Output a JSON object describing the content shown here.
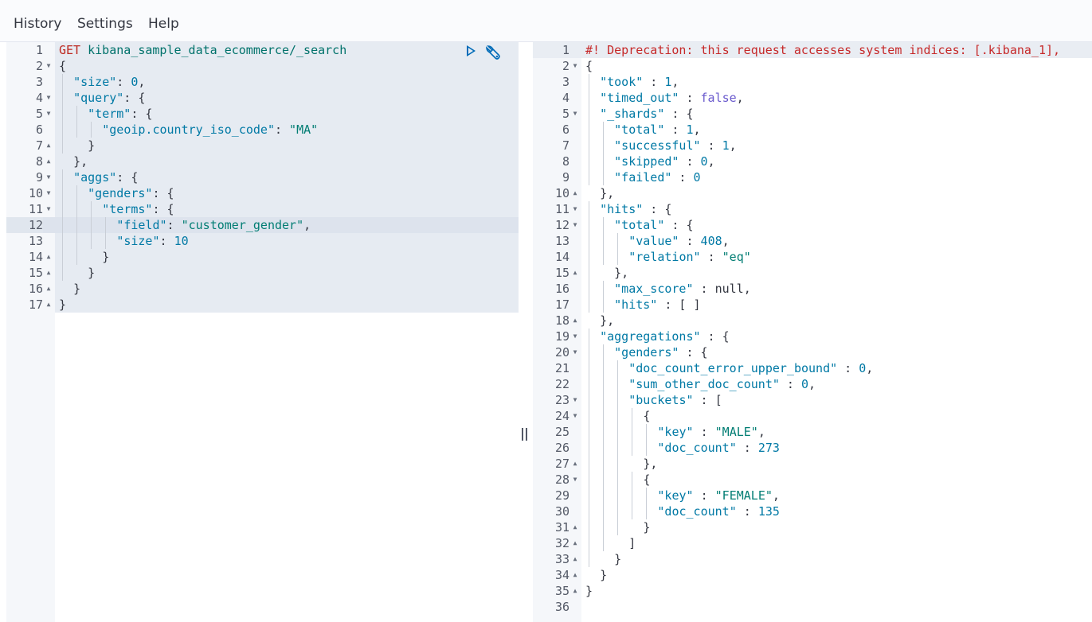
{
  "menu": {
    "history": "History",
    "settings": "Settings",
    "help": "Help"
  },
  "request": {
    "method": "GET",
    "path": "kibana_sample_data_ecommerce/_search",
    "lines": [
      {
        "n": "1",
        "fold": "",
        "indent": 0,
        "tokens": []
      },
      {
        "n": "2",
        "fold": "▼",
        "indent": 0,
        "tokens": [
          [
            "p",
            "{"
          ]
        ]
      },
      {
        "n": "3",
        "fold": "",
        "indent": 1,
        "tokens": [
          [
            "k",
            "\"size\""
          ],
          [
            "p",
            ": "
          ],
          [
            "n",
            "0"
          ],
          [
            "p",
            ","
          ]
        ]
      },
      {
        "n": "4",
        "fold": "▼",
        "indent": 1,
        "tokens": [
          [
            "k",
            "\"query\""
          ],
          [
            "p",
            ": {"
          ]
        ]
      },
      {
        "n": "5",
        "fold": "▼",
        "indent": 2,
        "tokens": [
          [
            "k",
            "\"term\""
          ],
          [
            "p",
            ": {"
          ]
        ]
      },
      {
        "n": "6",
        "fold": "",
        "indent": 3,
        "tokens": [
          [
            "k",
            "\"geoip.country_iso_code\""
          ],
          [
            "p",
            ": "
          ],
          [
            "s",
            "\"MA\""
          ]
        ]
      },
      {
        "n": "7",
        "fold": "▲",
        "indent": 2,
        "tokens": [
          [
            "p",
            "}"
          ]
        ]
      },
      {
        "n": "8",
        "fold": "▲",
        "indent": 1,
        "tokens": [
          [
            "p",
            "},"
          ]
        ]
      },
      {
        "n": "9",
        "fold": "▼",
        "indent": 1,
        "tokens": [
          [
            "k",
            "\"aggs\""
          ],
          [
            "p",
            ": {"
          ]
        ]
      },
      {
        "n": "10",
        "fold": "▼",
        "indent": 2,
        "tokens": [
          [
            "k",
            "\"genders\""
          ],
          [
            "p",
            ": {"
          ]
        ]
      },
      {
        "n": "11",
        "fold": "▼",
        "indent": 3,
        "tokens": [
          [
            "k",
            "\"terms\""
          ],
          [
            "p",
            ": {"
          ]
        ]
      },
      {
        "n": "12",
        "fold": "",
        "indent": 4,
        "tokens": [
          [
            "k",
            "\"field\""
          ],
          [
            "p",
            ": "
          ],
          [
            "s",
            "\"customer_gender\""
          ],
          [
            "p",
            ","
          ]
        ]
      },
      {
        "n": "13",
        "fold": "",
        "indent": 4,
        "tokens": [
          [
            "k",
            "\"size\""
          ],
          [
            "p",
            ": "
          ],
          [
            "n",
            "10"
          ]
        ]
      },
      {
        "n": "14",
        "fold": "▲",
        "indent": 3,
        "tokens": [
          [
            "p",
            "}"
          ]
        ]
      },
      {
        "n": "15",
        "fold": "▲",
        "indent": 2,
        "tokens": [
          [
            "p",
            "}"
          ]
        ]
      },
      {
        "n": "16",
        "fold": "▲",
        "indent": 1,
        "tokens": [
          [
            "p",
            "}"
          ]
        ]
      },
      {
        "n": "17",
        "fold": "▲",
        "indent": 0,
        "tokens": [
          [
            "p",
            "}"
          ]
        ]
      }
    ]
  },
  "response": {
    "lines": [
      {
        "n": "1",
        "fold": "",
        "indent": 0,
        "tokens": [
          [
            "w",
            "#! Deprecation: this request accesses system indices: [.kibana_1],"
          ]
        ]
      },
      {
        "n": "2",
        "fold": "▼",
        "indent": 0,
        "tokens": [
          [
            "p",
            "{"
          ]
        ]
      },
      {
        "n": "3",
        "fold": "",
        "indent": 1,
        "tokens": [
          [
            "k",
            "\"took\""
          ],
          [
            "p",
            " : "
          ],
          [
            "n",
            "1"
          ],
          [
            "p",
            ","
          ]
        ]
      },
      {
        "n": "4",
        "fold": "",
        "indent": 1,
        "tokens": [
          [
            "k",
            "\"timed_out\""
          ],
          [
            "p",
            " : "
          ],
          [
            "b",
            "false"
          ],
          [
            "p",
            ","
          ]
        ]
      },
      {
        "n": "5",
        "fold": "▼",
        "indent": 1,
        "tokens": [
          [
            "k",
            "\"_shards\""
          ],
          [
            "p",
            " : {"
          ]
        ]
      },
      {
        "n": "6",
        "fold": "",
        "indent": 2,
        "tokens": [
          [
            "k",
            "\"total\""
          ],
          [
            "p",
            " : "
          ],
          [
            "n",
            "1"
          ],
          [
            "p",
            ","
          ]
        ]
      },
      {
        "n": "7",
        "fold": "",
        "indent": 2,
        "tokens": [
          [
            "k",
            "\"successful\""
          ],
          [
            "p",
            " : "
          ],
          [
            "n",
            "1"
          ],
          [
            "p",
            ","
          ]
        ]
      },
      {
        "n": "8",
        "fold": "",
        "indent": 2,
        "tokens": [
          [
            "k",
            "\"skipped\""
          ],
          [
            "p",
            " : "
          ],
          [
            "n",
            "0"
          ],
          [
            "p",
            ","
          ]
        ]
      },
      {
        "n": "9",
        "fold": "",
        "indent": 2,
        "tokens": [
          [
            "k",
            "\"failed\""
          ],
          [
            "p",
            " : "
          ],
          [
            "n",
            "0"
          ]
        ]
      },
      {
        "n": "10",
        "fold": "▲",
        "indent": 1,
        "tokens": [
          [
            "p",
            "},"
          ]
        ]
      },
      {
        "n": "11",
        "fold": "▼",
        "indent": 1,
        "tokens": [
          [
            "k",
            "\"hits\""
          ],
          [
            "p",
            " : {"
          ]
        ]
      },
      {
        "n": "12",
        "fold": "▼",
        "indent": 2,
        "tokens": [
          [
            "k",
            "\"total\""
          ],
          [
            "p",
            " : {"
          ]
        ]
      },
      {
        "n": "13",
        "fold": "",
        "indent": 3,
        "tokens": [
          [
            "k",
            "\"value\""
          ],
          [
            "p",
            " : "
          ],
          [
            "n",
            "408"
          ],
          [
            "p",
            ","
          ]
        ]
      },
      {
        "n": "14",
        "fold": "",
        "indent": 3,
        "tokens": [
          [
            "k",
            "\"relation\""
          ],
          [
            "p",
            " : "
          ],
          [
            "s",
            "\"eq\""
          ]
        ]
      },
      {
        "n": "15",
        "fold": "▲",
        "indent": 2,
        "tokens": [
          [
            "p",
            "},"
          ]
        ]
      },
      {
        "n": "16",
        "fold": "",
        "indent": 2,
        "tokens": [
          [
            "k",
            "\"max_score\""
          ],
          [
            "p",
            " : "
          ],
          [
            "z",
            "null"
          ],
          [
            "p",
            ","
          ]
        ]
      },
      {
        "n": "17",
        "fold": "",
        "indent": 2,
        "tokens": [
          [
            "k",
            "\"hits\""
          ],
          [
            "p",
            " : [ ]"
          ]
        ]
      },
      {
        "n": "18",
        "fold": "▲",
        "indent": 1,
        "tokens": [
          [
            "p",
            "},"
          ]
        ]
      },
      {
        "n": "19",
        "fold": "▼",
        "indent": 1,
        "tokens": [
          [
            "k",
            "\"aggregations\""
          ],
          [
            "p",
            " : {"
          ]
        ]
      },
      {
        "n": "20",
        "fold": "▼",
        "indent": 2,
        "tokens": [
          [
            "k",
            "\"genders\""
          ],
          [
            "p",
            " : {"
          ]
        ]
      },
      {
        "n": "21",
        "fold": "",
        "indent": 3,
        "tokens": [
          [
            "k",
            "\"doc_count_error_upper_bound\""
          ],
          [
            "p",
            " : "
          ],
          [
            "n",
            "0"
          ],
          [
            "p",
            ","
          ]
        ]
      },
      {
        "n": "22",
        "fold": "",
        "indent": 3,
        "tokens": [
          [
            "k",
            "\"sum_other_doc_count\""
          ],
          [
            "p",
            " : "
          ],
          [
            "n",
            "0"
          ],
          [
            "p",
            ","
          ]
        ]
      },
      {
        "n": "23",
        "fold": "▼",
        "indent": 3,
        "tokens": [
          [
            "k",
            "\"buckets\""
          ],
          [
            "p",
            " : ["
          ]
        ]
      },
      {
        "n": "24",
        "fold": "▼",
        "indent": 4,
        "tokens": [
          [
            "p",
            "{"
          ]
        ]
      },
      {
        "n": "25",
        "fold": "",
        "indent": 5,
        "tokens": [
          [
            "k",
            "\"key\""
          ],
          [
            "p",
            " : "
          ],
          [
            "s",
            "\"MALE\""
          ],
          [
            "p",
            ","
          ]
        ]
      },
      {
        "n": "26",
        "fold": "",
        "indent": 5,
        "tokens": [
          [
            "k",
            "\"doc_count\""
          ],
          [
            "p",
            " : "
          ],
          [
            "n",
            "273"
          ]
        ]
      },
      {
        "n": "27",
        "fold": "▲",
        "indent": 4,
        "tokens": [
          [
            "p",
            "},"
          ]
        ]
      },
      {
        "n": "28",
        "fold": "▼",
        "indent": 4,
        "tokens": [
          [
            "p",
            "{"
          ]
        ]
      },
      {
        "n": "29",
        "fold": "",
        "indent": 5,
        "tokens": [
          [
            "k",
            "\"key\""
          ],
          [
            "p",
            " : "
          ],
          [
            "s",
            "\"FEMALE\""
          ],
          [
            "p",
            ","
          ]
        ]
      },
      {
        "n": "30",
        "fold": "",
        "indent": 5,
        "tokens": [
          [
            "k",
            "\"doc_count\""
          ],
          [
            "p",
            " : "
          ],
          [
            "n",
            "135"
          ]
        ]
      },
      {
        "n": "31",
        "fold": "▲",
        "indent": 4,
        "tokens": [
          [
            "p",
            "}"
          ]
        ]
      },
      {
        "n": "32",
        "fold": "▲",
        "indent": 3,
        "tokens": [
          [
            "p",
            "]"
          ]
        ]
      },
      {
        "n": "33",
        "fold": "▲",
        "indent": 2,
        "tokens": [
          [
            "p",
            "}"
          ]
        ]
      },
      {
        "n": "34",
        "fold": "▲",
        "indent": 1,
        "tokens": [
          [
            "p",
            "}"
          ]
        ]
      },
      {
        "n": "35",
        "fold": "▲",
        "indent": 0,
        "tokens": [
          [
            "p",
            "}"
          ]
        ]
      },
      {
        "n": "36",
        "fold": "",
        "indent": 0,
        "tokens": []
      }
    ]
  },
  "icons": {
    "send": "play-icon",
    "settings": "wrench-icon"
  }
}
